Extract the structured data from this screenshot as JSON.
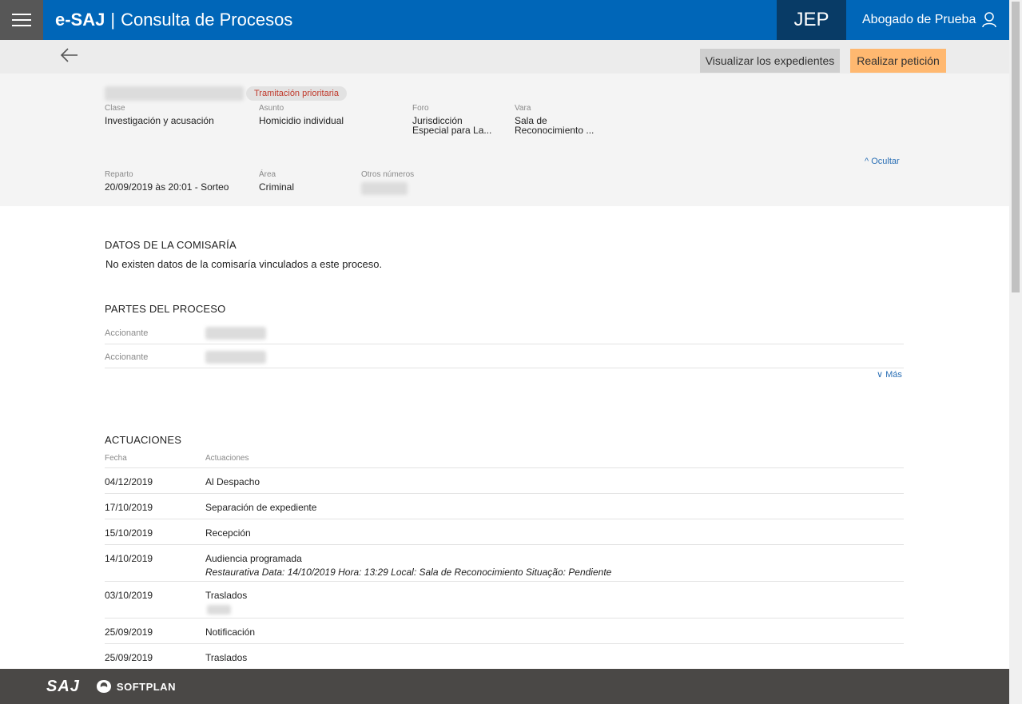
{
  "header": {
    "brand_bold": "e-SAJ",
    "separator": "|",
    "brand_title": "Consulta de Procesos",
    "court": "JEP",
    "user_name": "Abogado de Prueba"
  },
  "actions": {
    "view_files": "Visualizar los expedientes",
    "make_petition": "Realizar petición"
  },
  "summary": {
    "badge": "Tramitación prioritaria",
    "clase_label": "Clase",
    "clase_value": "Investigación y acusación",
    "asunto_label": "Asunto",
    "asunto_value": "Homicidio individual",
    "foro_label": "Foro",
    "foro_value_1": "Jurisdicción",
    "foro_value_2": "Especial para La...",
    "vara_label": "Vara",
    "vara_value_1": "Sala de",
    "vara_value_2": "Reconocimiento ...",
    "hide_label": "Ocultar",
    "reparto_label": "Reparto",
    "reparto_value": "20/09/2019 às 20:01 - Sorteo",
    "area_label": "Área",
    "area_value": "Criminal",
    "otros_label": "Otros números"
  },
  "police": {
    "title": "DATOS DE LA COMISARÍA",
    "text": "No existen datos de la comisaría vinculados a este proceso."
  },
  "parties": {
    "title": "PARTES DEL PROCESO",
    "rows": [
      {
        "label": "Accionante"
      },
      {
        "label": "Accionante"
      }
    ],
    "more_label": "Más"
  },
  "movements": {
    "title": "ACTUACIONES",
    "col_date": "Fecha",
    "col_action": "Actuaciones",
    "rows": [
      {
        "date": "04/12/2019",
        "action": "Al Despacho",
        "detail": ""
      },
      {
        "date": "17/10/2019",
        "action": "Separación de expediente",
        "detail": ""
      },
      {
        "date": "15/10/2019",
        "action": "Recepción",
        "detail": ""
      },
      {
        "date": "14/10/2019",
        "action": "Audiencia programada",
        "detail": "Restaurativa Data: 14/10/2019 Hora: 13:29 Local: Sala de Reconocimiento Situação: Pendiente"
      },
      {
        "date": "03/10/2019",
        "action": "Traslados",
        "detail": ""
      },
      {
        "date": "25/09/2019",
        "action": "Notificación",
        "detail": ""
      },
      {
        "date": "25/09/2019",
        "action": "Traslados",
        "detail": ""
      }
    ]
  },
  "footer": {
    "saj": "SAJ",
    "softplan": "SOFTPLAN"
  }
}
